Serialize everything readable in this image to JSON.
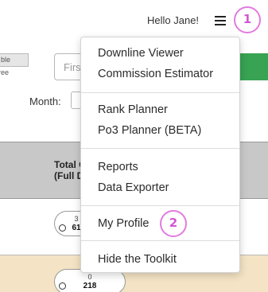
{
  "header": {
    "greeting": "Hello Jane!"
  },
  "markers": {
    "first": "1",
    "second": "2"
  },
  "menu": {
    "items": [
      {
        "label": "Downline Viewer"
      },
      {
        "label": "Commission Estimator"
      },
      {
        "label": "Rank Planner"
      },
      {
        "label": "Po3 Planner (BETA)"
      },
      {
        "label": "Reports"
      },
      {
        "label": "Data Exporter"
      },
      {
        "label": "My Profile"
      },
      {
        "label": "Hide the Toolkit"
      }
    ]
  },
  "background": {
    "tag_label": "ble",
    "tag_sub": "ree",
    "name_input_placeholder": "Firs",
    "month_label": "Month:",
    "column_header_line1": "Total C",
    "column_header_line2": "(Full D",
    "row1_count": "3",
    "row1_value": "61",
    "row2_count": "0",
    "row2_value": "218"
  },
  "colors": {
    "marker_accent": "#e27be0",
    "green_button": "#37a353",
    "tan_row": "#f4e3c4",
    "header_band": "#c8c8c8"
  }
}
